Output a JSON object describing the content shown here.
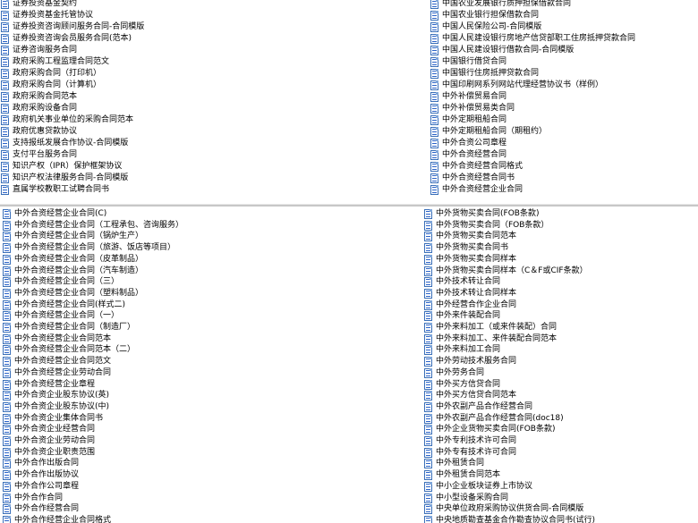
{
  "top_left": [
    "证券投资基金契约",
    "证券投资基金托管协议",
    "证券投资咨询顾问服务合同-合同模版",
    "证券投资咨询会员服务合同(范本)",
    "证券咨询服务合同",
    "政府采购工程监理合同范文",
    "政府采购合同（打印机）",
    "政府采购合同（计算机）",
    "政府采购合同范本",
    "政府采购设备合同",
    "政府机关事业单位的采购合同范本",
    "政府优惠贷款协议",
    "支持报纸发展合作协议-合同模版",
    "支付平台服务合同",
    "知识产权（IPR）保护框架协议",
    "知识产权法律服务合同-合同模版",
    "直属学校教职工试聘合同书"
  ],
  "top_right": [
    "中国农业发展银行质押担保借款合同",
    "中国农业银行担保借款合同",
    "中国人民保险公司-合同模版",
    "中国人民建设银行房地产信贷部职工住房抵押贷款合同",
    "中国人民建设银行借款合同-合同模版",
    "中国银行借贷合同",
    "中国银行住房抵押贷款合同",
    "中国印刷网系列网站代理经营协议书（样例）",
    "中外补偿贸易合同",
    "中外补偿贸易类合同",
    "中外定期租船合同",
    "中外定期租船合同（期租约）",
    "中外合资公司章程",
    "中外合资经营合同",
    "中外合资经营合同格式",
    "中外合资经营合同书",
    "中外合资经营企业合同"
  ],
  "bottom_left": [
    "中外合资经营企业合同(C)",
    "中外合资经营企业合同（工程承包、咨询服务）",
    "中外合资经营企业合同（锅炉生产）",
    "中外合资经营企业合同（旅游、饭店等项目）",
    "中外合资经营企业合同（皮革制品）",
    "中外合资经营企业合同（汽车制造）",
    "中外合资经营企业合同（三）",
    "中外合资经营企业合同（塑料制品）",
    "中外合资经营企业合同(样式二)",
    "中外合资经营企业合同（一）",
    "中外合资经营企业合同（制造厂）",
    "中外合资经营企业合同范本",
    "中外合资经营企业合同范本（二）",
    "中外合资经营企业合同范文",
    "中外合资经营企业劳动合同",
    "中外合资经营企业章程",
    "中外合资企业股东协议(英)",
    "中外合资企业股东协议(中)",
    "中外合资企业集体合同书",
    "中外合资企业经营合同",
    "中外合资企业劳动合同",
    "中外合资企业职责范围",
    "中外合作出版合同",
    "中外合作出版协议",
    "中外合作公司章程",
    "中外合作合同",
    "中外合作经营合同",
    "中外合作经营企业合同格式"
  ],
  "bottom_right": [
    "中外货物买卖合同(FOB条款)",
    "中外货物买卖合同（FOB条款）",
    "中外货物买卖合同范本",
    "中外货物买卖合同书",
    "中外货物买卖合同样本",
    "中外货物买卖合同样本（C＆F或CIF条款）",
    "中外技术转让合同",
    "中外技术转让合同样本",
    "中外经营合作企业合同",
    "中外来件装配合同",
    "中外来料加工（或来件装配）合同",
    "中外来料加工、来件装配合同范本",
    "中外来料加工合同",
    "中外劳动技术服务合同",
    "中外劳务合同",
    "中外买方信贷合同",
    "中外买方信贷合同范本",
    "中外农副产品合作经营合同",
    "中外农副产品合作经营合同(doc18)",
    "中外企业货物买卖合同(FOB条款)",
    "中外专利技术许可合同",
    "中外专有技术许可合同",
    "中外租赁合同",
    "中外租赁合同范本",
    "中小企业板块证券上市协议",
    "中小型设备采购合同",
    "中央单位政府采购协议供货合同-合同模版",
    "中央地质勘查基金合作勘查协议合同书(试行)"
  ]
}
